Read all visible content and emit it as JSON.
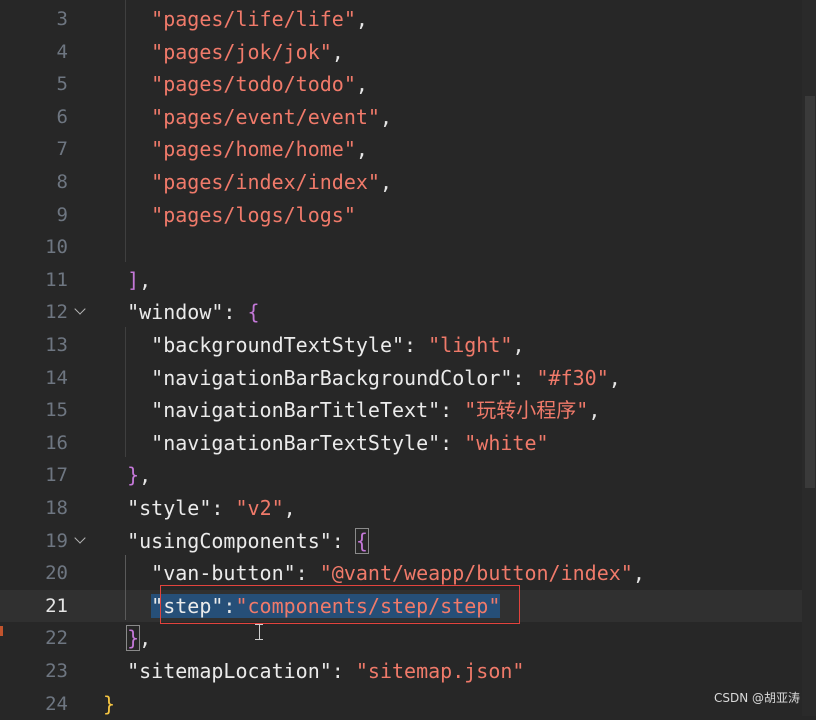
{
  "editor": {
    "lines": [
      {
        "num": "3",
        "indent": "  ",
        "tokens": [
          {
            "t": "\"pages/life/life\"",
            "c": "s"
          },
          {
            "t": ",",
            "c": "p"
          }
        ]
      },
      {
        "num": "4",
        "indent": "  ",
        "tokens": [
          {
            "t": "\"pages/jok/jok\"",
            "c": "s"
          },
          {
            "t": ",",
            "c": "p"
          }
        ]
      },
      {
        "num": "5",
        "indent": "  ",
        "tokens": [
          {
            "t": "\"pages/todo/todo\"",
            "c": "s"
          },
          {
            "t": ",",
            "c": "p"
          }
        ]
      },
      {
        "num": "6",
        "indent": "  ",
        "tokens": [
          {
            "t": "\"pages/event/event\"",
            "c": "s"
          },
          {
            "t": ",",
            "c": "p"
          }
        ]
      },
      {
        "num": "7",
        "indent": "  ",
        "tokens": [
          {
            "t": "\"pages/home/home\"",
            "c": "s"
          },
          {
            "t": ",",
            "c": "p"
          }
        ]
      },
      {
        "num": "8",
        "indent": "  ",
        "tokens": [
          {
            "t": "\"pages/index/index\"",
            "c": "s"
          },
          {
            "t": ",",
            "c": "p"
          }
        ]
      },
      {
        "num": "9",
        "indent": "  ",
        "tokens": [
          {
            "t": "\"pages/logs/logs\"",
            "c": "s"
          }
        ]
      },
      {
        "num": "10",
        "indent": "",
        "tokens": []
      },
      {
        "num": "11",
        "indent": "",
        "tokens": [
          {
            "t": "]",
            "c": "bp"
          },
          {
            "t": ",",
            "c": "p"
          }
        ]
      },
      {
        "num": "12",
        "indent": "",
        "fold": true,
        "tokens": [
          {
            "t": "\"window\"",
            "c": "k"
          },
          {
            "t": ": ",
            "c": "p"
          },
          {
            "t": "{",
            "c": "bp"
          }
        ]
      },
      {
        "num": "13",
        "indent": "  ",
        "tokens": [
          {
            "t": "\"backgroundTextStyle\"",
            "c": "k"
          },
          {
            "t": ": ",
            "c": "p"
          },
          {
            "t": "\"light\"",
            "c": "s"
          },
          {
            "t": ",",
            "c": "p"
          }
        ]
      },
      {
        "num": "14",
        "indent": "  ",
        "tokens": [
          {
            "t": "\"navigationBarBackgroundColor\"",
            "c": "k"
          },
          {
            "t": ": ",
            "c": "p"
          },
          {
            "t": "\"#f30\"",
            "c": "s"
          },
          {
            "t": ",",
            "c": "p"
          }
        ]
      },
      {
        "num": "15",
        "indent": "  ",
        "tokens": [
          {
            "t": "\"navigationBarTitleText\"",
            "c": "k"
          },
          {
            "t": ": ",
            "c": "p"
          },
          {
            "t": "\"玩转小程序\"",
            "c": "s"
          },
          {
            "t": ",",
            "c": "p"
          }
        ]
      },
      {
        "num": "16",
        "indent": "  ",
        "tokens": [
          {
            "t": "\"navigationBarTextStyle\"",
            "c": "k"
          },
          {
            "t": ": ",
            "c": "p"
          },
          {
            "t": "\"white\"",
            "c": "s"
          }
        ]
      },
      {
        "num": "17",
        "indent": "",
        "tokens": [
          {
            "t": "}",
            "c": "bp"
          },
          {
            "t": ",",
            "c": "p"
          }
        ]
      },
      {
        "num": "18",
        "indent": "",
        "tokens": [
          {
            "t": "\"style\"",
            "c": "k"
          },
          {
            "t": ": ",
            "c": "p"
          },
          {
            "t": "\"v2\"",
            "c": "s"
          },
          {
            "t": ",",
            "c": "p"
          }
        ]
      },
      {
        "num": "19",
        "indent": "",
        "fold": true,
        "tokens": [
          {
            "t": "\"usingComponents\"",
            "c": "k"
          },
          {
            "t": ": ",
            "c": "p"
          },
          {
            "t": "{",
            "c": "bp box"
          }
        ]
      },
      {
        "num": "20",
        "indent": "  ",
        "tokens": [
          {
            "t": "\"van-button\"",
            "c": "k"
          },
          {
            "t": ": ",
            "c": "p"
          },
          {
            "t": "\"@vant/weapp/button/index\"",
            "c": "s"
          },
          {
            "t": ",",
            "c": "p"
          }
        ]
      },
      {
        "num": "21",
        "indent": "  ",
        "current": true,
        "tokens": [
          {
            "t": "\"step\"",
            "c": "k sel"
          },
          {
            "t": ":",
            "c": "p sel"
          },
          {
            "t": "\"components/step/step\"",
            "c": "s sel"
          }
        ]
      },
      {
        "num": "22",
        "indent": "",
        "tokens": [
          {
            "t": "}",
            "c": "bp box"
          },
          {
            "t": ",",
            "c": "p"
          }
        ]
      },
      {
        "num": "23",
        "indent": "",
        "tokens": [
          {
            "t": "\"sitemapLocation\"",
            "c": "k"
          },
          {
            "t": ": ",
            "c": "p"
          },
          {
            "t": "\"sitemap.json\"",
            "c": "s"
          }
        ]
      },
      {
        "num": "24",
        "indent": "",
        "tokens": [
          {
            "t": "}",
            "c": "by"
          }
        ],
        "outer": true
      }
    ]
  },
  "watermark": "CSDN @胡亚涛",
  "colors": {
    "background": "#272727",
    "string": "#f07a6a",
    "key": "#ebebeb",
    "bracket_purple": "#c478d8",
    "bracket_yellow": "#f5c542",
    "selection": "#264f78",
    "find_highlight_border": "#e2433d"
  }
}
